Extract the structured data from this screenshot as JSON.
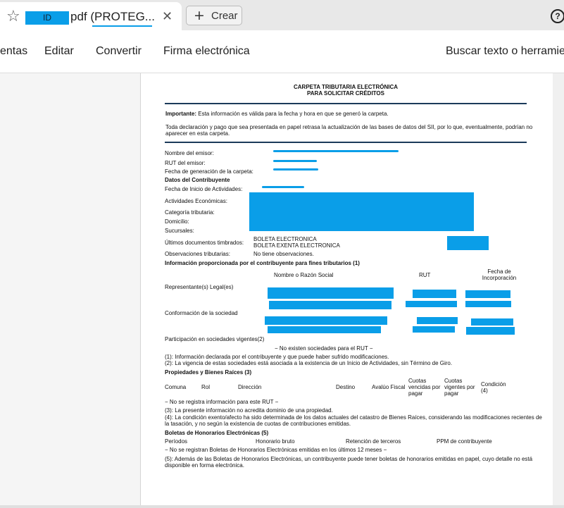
{
  "browser": {
    "tab_id_label": "ID",
    "tab_title": "pdf (PROTEG...",
    "crear_label": "Crear",
    "help_label": "?"
  },
  "menu": {
    "items": [
      "entas",
      "Editar",
      "Convertir",
      "Firma electrónica"
    ],
    "search": "Buscar texto o herramie"
  },
  "doc": {
    "title1": "CARPETA TRIBUTARIA ELECTRÓNICA",
    "title2": "PARA SOLICITAR CRÉDITOS",
    "important_label": "Importante:",
    "important_text": "Esta información es válida para la fecha y hora en que se generó la carpeta.",
    "note1": "Toda declaración y pago que sea presentada en papel retrasa la actualización de las bases de datos del SII, por lo que, eventualmente, podrían no",
    "note2": "aparecer en esta carpeta.",
    "emisor_name_label": "Nombre del emisor:",
    "emisor_rut_label": "RUT del emisor:",
    "fecha_gen_label": "Fecha de generación de la carpeta:",
    "datos_contrib": "Datos del Contribuyente",
    "fecha_inicio_label": "Fecha de Inicio de Actividades:",
    "actividades_label": "Actividades Económicas:",
    "categoria_label": "Categoría tributaria:",
    "domicilio_label": "Domicilio:",
    "sucursales_label": "Sucursales:",
    "ultimos_label": "Últimos documentos timbrados:",
    "ultimos_val1": "BOLETA ELECTRONICA",
    "ultimos_val2": "BOLETA EXENTA ELECTRONICA",
    "observ_label": "Observaciones tributarias:",
    "observ_val": "No tiene observaciones.",
    "info_prop": "Información proporcionada por el contribuyente para fines tributarios (1)",
    "col_nombre": "Nombre o Razón Social",
    "col_rut": "RUT",
    "col_fecha1": "Fecha de",
    "col_fecha2": "Incorporación",
    "representantes": "Representante(s) Legal(es)",
    "conformacion": "Conformación de la sociedad",
    "participacion": "Participación en sociedades vigentes(2)",
    "no_sociedades": "− No existen sociedades para el RUT −",
    "fn1": "(1): Información declarada por el contribuyente y que puede haber sufrido modificaciones.",
    "fn2": "(2): La vigencia de estas sociedades está asociada a la existencia de un Inicio de Actividades, sin Término de Giro.",
    "propiedades": "Propiedades y Bienes Raíces (3)",
    "prop_cols": [
      "Comuna",
      "Rol",
      "Dirección",
      "Destino",
      "Avalúo Fiscal"
    ],
    "cuotas_vencidas": [
      "Cuotas",
      "vencidas por",
      "pagar"
    ],
    "cuotas_vigentes": [
      "Cuotas",
      "vigentes por",
      "pagar"
    ],
    "condicion": [
      "Condición",
      "(4)"
    ],
    "no_info": "− No se registra información para este RUT −",
    "fn3": "(3): La presente información no acredita dominio de una propiedad.",
    "fn4a": "(4): La condición exento/afecto ha sido determinada de los datos actuales del catastro de Bienes Raíces, considerando las modificaciones recientes de",
    "fn4b": "la tasación, y no según la existencia de cuotas de contribuciones emitidas.",
    "boletas": "Boletas de Honorarios Electrónicas (5)",
    "bol_cols": [
      "Períodos",
      "Honorario bruto",
      "Retención de terceros",
      "PPM de contribuyente"
    ],
    "no_boletas": "− No se registran Boletas de Honorarios Electrónicas emitidas en los últimos 12 meses −",
    "fn5a": "(5): Además de las Boletas de Honorarios Electrónicas, un contribuyente puede tener boletas de honorarios emitidas en papel, cuyo detalle no está",
    "fn5b": "disponible en forma electrónica."
  },
  "colors": {
    "redaction": "#0a9ee8",
    "rule": "#1c3b5a"
  }
}
